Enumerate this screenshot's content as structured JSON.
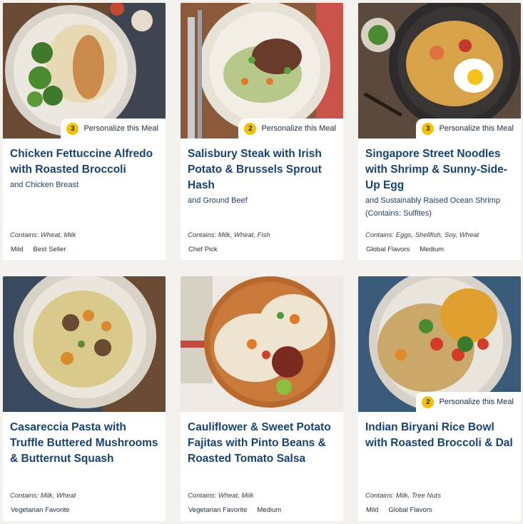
{
  "personalize_label": "Personalize this Meal",
  "meals": [
    {
      "title": "Chicken Fettuccine Alfredo with Roasted Broccoli",
      "subtitle": "and Chicken Breast",
      "contains": "Contains: Wheat, Milk",
      "tags": [
        "Mild",
        "Best Seller"
      ],
      "badge": "3"
    },
    {
      "title": "Salisbury Steak with Irish Potato & Brussels Sprout Hash",
      "subtitle": "and Ground Beef",
      "contains": "Contains: Milk, Wheat, Fish",
      "tags": [
        "Chef Pick"
      ],
      "badge": "2"
    },
    {
      "title": "Singapore Street Noodles with Shrimp & Sunny-Side-Up Egg",
      "subtitle": "and Sustainably Raised Ocean Shrimp (Contains: Sulfites)",
      "contains": "Contains: Eggs, Shellfish, Soy, Wheat",
      "tags": [
        "Global Flavors",
        "Medium"
      ],
      "badge": "3"
    },
    {
      "title": "Casareccia Pasta with Truffle Buttered Mushrooms & Butternut Squash",
      "subtitle": "",
      "contains": "Contains: Milk, Wheat",
      "tags": [
        "Vegetarian Favorite"
      ],
      "badge": ""
    },
    {
      "title": "Cauliflower & Sweet Potato Fajitas with Pinto Beans & Roasted Tomato Salsa",
      "subtitle": "",
      "contains": "Contains: Wheat, Milk",
      "tags": [
        "Vegetarian Favorite",
        "Medium"
      ],
      "badge": ""
    },
    {
      "title": "Indian Biryani Rice Bowl with Roasted Broccoli & Dal",
      "subtitle": "",
      "contains": "Contains: Milk, Tree Nuts",
      "tags": [
        "Mild",
        "Global Flavors"
      ],
      "badge": "2"
    }
  ]
}
